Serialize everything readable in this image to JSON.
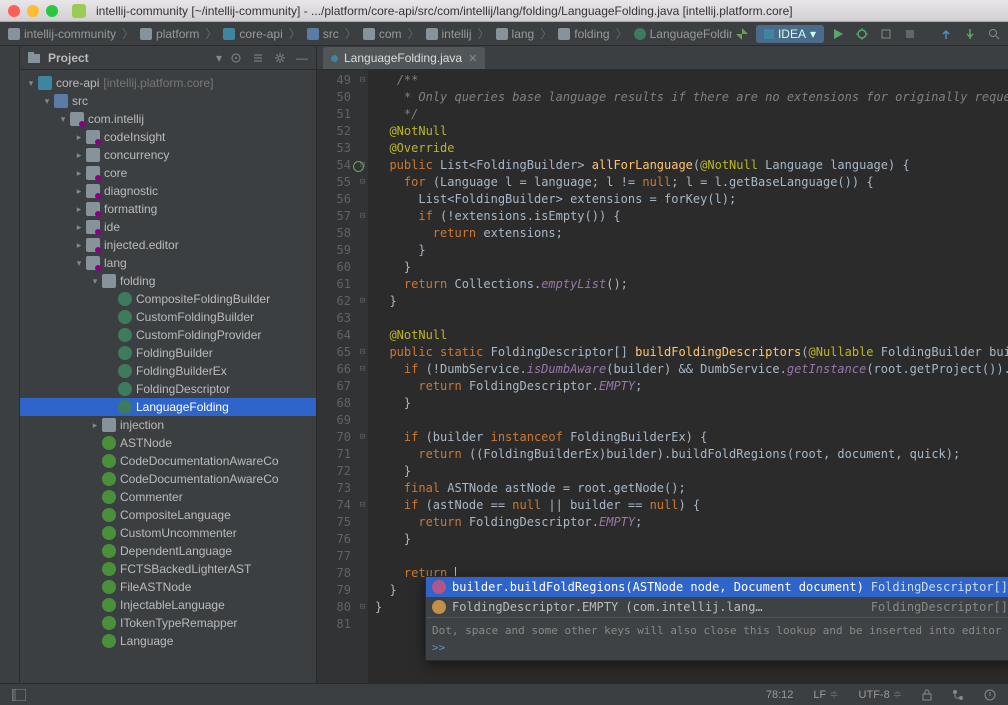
{
  "title": "intellij-community [~/intellij-community] - .../platform/core-api/src/com/intellij/lang/folding/LanguageFolding.java [intellij.platform.core]",
  "runconfig": "IDEA",
  "breadcrumbs": [
    {
      "label": "intellij-community",
      "icon": "folder"
    },
    {
      "label": "platform",
      "icon": "folder"
    },
    {
      "label": "core-api",
      "icon": "module"
    },
    {
      "label": "src",
      "icon": "src"
    },
    {
      "label": "com",
      "icon": "folder"
    },
    {
      "label": "intellij",
      "icon": "folder"
    },
    {
      "label": "lang",
      "icon": "folder"
    },
    {
      "label": "folding",
      "icon": "folder"
    },
    {
      "label": "LanguageFolding",
      "icon": "class"
    }
  ],
  "project": {
    "toolwindow_label": "Project",
    "tree": [
      {
        "d": 0,
        "exp": "▾",
        "icon": "mod",
        "label": "core-api",
        "qual": "[intellij.platform.core]"
      },
      {
        "d": 1,
        "exp": "▾",
        "icon": "src",
        "label": "src"
      },
      {
        "d": 2,
        "exp": "▾",
        "icon": "folder-dot",
        "label": "com.intellij"
      },
      {
        "d": 3,
        "exp": "▸",
        "icon": "folder-dot",
        "label": "codeInsight"
      },
      {
        "d": 3,
        "exp": "▸",
        "icon": "folder",
        "label": "concurrency"
      },
      {
        "d": 3,
        "exp": "▸",
        "icon": "folder-dot",
        "label": "core"
      },
      {
        "d": 3,
        "exp": "▸",
        "icon": "folder-dot",
        "label": "diagnostic"
      },
      {
        "d": 3,
        "exp": "▸",
        "icon": "folder-dot",
        "label": "formatting"
      },
      {
        "d": 3,
        "exp": "▸",
        "icon": "folder-dot",
        "label": "ide"
      },
      {
        "d": 3,
        "exp": "▸",
        "icon": "folder-dot",
        "label": "injected.editor"
      },
      {
        "d": 3,
        "exp": "▾",
        "icon": "folder-dot",
        "label": "lang"
      },
      {
        "d": 4,
        "exp": "▾",
        "icon": "folder",
        "label": "folding"
      },
      {
        "d": 5,
        "exp": "",
        "icon": "class",
        "label": "CompositeFoldingBuilder"
      },
      {
        "d": 5,
        "exp": "",
        "icon": "class",
        "label": "CustomFoldingBuilder"
      },
      {
        "d": 5,
        "exp": "",
        "icon": "class",
        "label": "CustomFoldingProvider"
      },
      {
        "d": 5,
        "exp": "",
        "icon": "class",
        "label": "FoldingBuilder"
      },
      {
        "d": 5,
        "exp": "",
        "icon": "class",
        "label": "FoldingBuilderEx"
      },
      {
        "d": 5,
        "exp": "",
        "icon": "class",
        "label": "FoldingDescriptor"
      },
      {
        "d": 5,
        "exp": "",
        "icon": "class",
        "label": "LanguageFolding",
        "sel": true
      },
      {
        "d": 4,
        "exp": "▸",
        "icon": "folder",
        "label": "injection"
      },
      {
        "d": 4,
        "exp": "",
        "icon": "iface",
        "label": "ASTNode"
      },
      {
        "d": 4,
        "exp": "",
        "icon": "iface",
        "label": "CodeDocumentationAwareCo"
      },
      {
        "d": 4,
        "exp": "",
        "icon": "iface",
        "label": "CodeDocumentationAwareCo"
      },
      {
        "d": 4,
        "exp": "",
        "icon": "iface",
        "label": "Commenter"
      },
      {
        "d": 4,
        "exp": "",
        "icon": "iface",
        "label": "CompositeLanguage"
      },
      {
        "d": 4,
        "exp": "",
        "icon": "iface",
        "label": "CustomUncommenter"
      },
      {
        "d": 4,
        "exp": "",
        "icon": "iface",
        "label": "DependentLanguage"
      },
      {
        "d": 4,
        "exp": "",
        "icon": "iface",
        "label": "FCTSBackedLighterAST"
      },
      {
        "d": 4,
        "exp": "",
        "icon": "iface",
        "label": "FileASTNode"
      },
      {
        "d": 4,
        "exp": "",
        "icon": "iface",
        "label": "InjectableLanguage"
      },
      {
        "d": 4,
        "exp": "",
        "icon": "iface",
        "label": "ITokenTypeRemapper"
      },
      {
        "d": 4,
        "exp": "",
        "icon": "iface",
        "label": "Language"
      }
    ]
  },
  "tab": {
    "label": "LanguageFolding.java"
  },
  "gutter": {
    "start": 49,
    "end": 81,
    "impl": 54,
    "folds": {
      "49": "⊟",
      "54": "⊟",
      "55": "⊟",
      "57": "⊟",
      "62": "⊟",
      "65": "⊟",
      "66": "⊟",
      "70": "⊟",
      "74": "⊟",
      "80": "⊟"
    }
  },
  "code": [
    {
      "html": "   <span class='com'>/**</span>"
    },
    {
      "html": "   <span class='com'> * Only queries base language results if there are no extensions for originally requested</span>"
    },
    {
      "html": "   <span class='com'> */</span>"
    },
    {
      "html": "  <span class='ann'>@NotNull</span>"
    },
    {
      "html": "  <span class='ann'>@Override</span>"
    },
    {
      "html": "  <span class='kw'>public</span> List&lt;FoldingBuilder&gt; <span class='fn'>allForLanguage</span>(<span class='ann'>@NotNull</span> Language <span class='param'>language</span>) {"
    },
    {
      "html": "    <span class='kw'>for</span> (Language l = language; l != <span class='kw'>null</span>; l = l.getBaseLanguage()) {"
    },
    {
      "html": "      List&lt;FoldingBuilder&gt; extensions = forKey(l);"
    },
    {
      "html": "      <span class='kw'>if</span> (!extensions.isEmpty()) {"
    },
    {
      "html": "        <span class='kw'>return</span> extensions;"
    },
    {
      "html": "      }"
    },
    {
      "html": "    }"
    },
    {
      "html": "    <span class='kw'>return</span> Collections.<span class='fld'>emptyList</span>();"
    },
    {
      "html": "  }"
    },
    {
      "html": ""
    },
    {
      "html": "  <span class='ann'>@NotNull</span>"
    },
    {
      "html": "  <span class='kw'>public static</span> FoldingDescriptor[] <span class='fn'>buildFoldingDescriptors</span>(<span class='ann'>@Nullable</span> FoldingBuilder builder"
    },
    {
      "html": "    <span class='kw'>if</span> (!DumbService.<span class='fld'>isDumbAware</span>(builder) &amp;&amp; DumbService.<span class='fld'>getInstance</span>(root.getProject()).isDum"
    },
    {
      "html": "      <span class='kw'>return</span> FoldingDescriptor.<span class='fld'>EMPTY</span>;"
    },
    {
      "html": "    }"
    },
    {
      "html": ""
    },
    {
      "html": "    <span class='kw'>if</span> (builder <span class='kw'>instanceof</span> FoldingBuilderEx) {"
    },
    {
      "html": "      <span class='kw'>return</span> ((FoldingBuilderEx)builder).buildFoldRegions(root, document, quick);"
    },
    {
      "html": "    }"
    },
    {
      "html": "    <span class='kw'>final</span> ASTNode astNode = root.getNode();"
    },
    {
      "html": "    <span class='kw'>if</span> (astNode == <span class='kw'>null</span> || builder == <span class='kw'>null</span>) {"
    },
    {
      "html": "      <span class='kw'>return</span> FoldingDescriptor.<span class='fld'>EMPTY</span>;"
    },
    {
      "html": "    }"
    },
    {
      "html": ""
    },
    {
      "html": "    <span class='kw'>return</span> <span class='caret'></span>"
    },
    {
      "html": "  }"
    },
    {
      "html": "}"
    },
    {
      "html": ""
    }
  ],
  "completion": {
    "items": [
      {
        "icon": "m",
        "main": "builder.buildFoldRegions(ASTNode node, Document document)",
        "type": "FoldingDescriptor[]",
        "sel": true
      },
      {
        "icon": "f",
        "main": "FoldingDescriptor.EMPTY (com.intellij.lang…",
        "type": "FoldingDescriptor[]"
      }
    ],
    "hint": "Dot, space and some other keys will also close this lookup and be inserted into editor",
    "more": ">>"
  },
  "status": {
    "pos": "78:12",
    "linesep": "LF",
    "encoding": "UTF-8"
  }
}
